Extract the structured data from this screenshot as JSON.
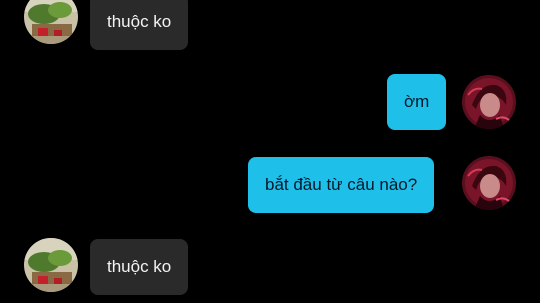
{
  "messages": [
    {
      "direction": "incoming",
      "text": "thuộc ko",
      "avatar": "friend-avatar"
    },
    {
      "direction": "outgoing",
      "text": "ờm",
      "avatar": "self-avatar"
    },
    {
      "direction": "outgoing",
      "text": "bắt đầu từ câu nào?",
      "avatar": "self-avatar"
    },
    {
      "direction": "incoming",
      "text": "thuộc ko",
      "avatar": "friend-avatar"
    }
  ],
  "colors": {
    "background": "#000000",
    "incoming_bubble": "#2a2a2a",
    "outgoing_bubble": "#1ec0ea",
    "incoming_text": "#f2f2f2",
    "outgoing_text": "#07182a"
  }
}
